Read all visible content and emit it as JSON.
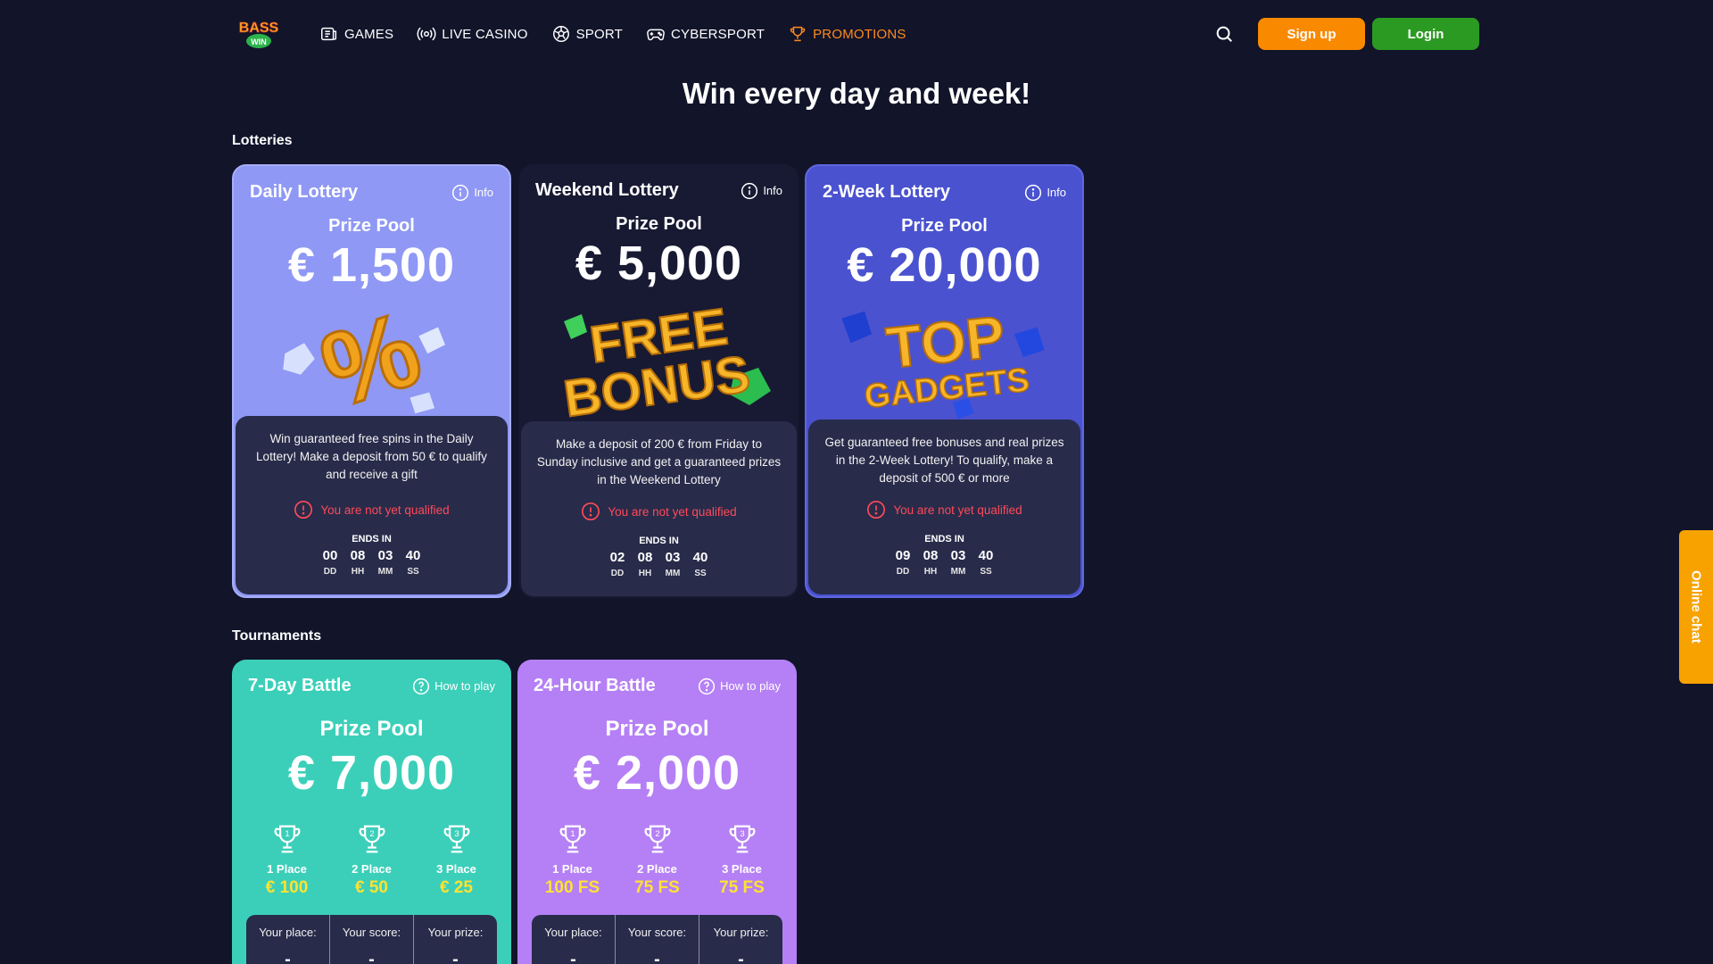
{
  "header": {
    "logo_text": "BASS WIN",
    "nav": [
      {
        "label": "GAMES",
        "icon": "games-icon"
      },
      {
        "label": "LIVE CASINO",
        "icon": "live-casino-icon"
      },
      {
        "label": "SPORT",
        "icon": "soccer-ball-icon"
      },
      {
        "label": "CYBERSPORT",
        "icon": "gamepad-icon"
      },
      {
        "label": "PROMOTIONS",
        "icon": "trophy-icon",
        "active": true
      }
    ],
    "signup_label": "Sign up",
    "login_label": "Login"
  },
  "page_title": "Win every day and week!",
  "lotteries": {
    "section_title": "Lotteries",
    "cards": [
      {
        "name": "Daily Lottery",
        "info_label": "Info",
        "prize_label": "Prize Pool",
        "prize_amount": "€ 1,500",
        "art": "percent-crystals",
        "description": "Win guaranteed free spins in the Daily Lottery! Make a deposit from 50 € to qualify and receive a gift",
        "status": "You are not yet qualified",
        "ends_in_label": "ENDS IN",
        "timer": [
          {
            "v": "00",
            "l": "DD"
          },
          {
            "v": "08",
            "l": "HH"
          },
          {
            "v": "03",
            "l": "MM"
          },
          {
            "v": "40",
            "l": "SS"
          }
        ],
        "bg_color": "#8f98f4"
      },
      {
        "name": "Weekend Lottery",
        "info_label": "Info",
        "prize_label": "Prize Pool",
        "prize_amount": "€ 5,000",
        "art": "free-bonus",
        "description": "Make a deposit of 200 € from Friday to Sunday inclusive and get a guaranteed prizes in the Weekend Lottery",
        "status": "You are not yet qualified",
        "ends_in_label": "ENDS IN",
        "timer": [
          {
            "v": "02",
            "l": "DD"
          },
          {
            "v": "08",
            "l": "HH"
          },
          {
            "v": "03",
            "l": "MM"
          },
          {
            "v": "40",
            "l": "SS"
          }
        ],
        "bg_color": "#181a33"
      },
      {
        "name": "2-Week Lottery",
        "info_label": "Info",
        "prize_label": "Prize Pool",
        "prize_amount": "€ 20,000",
        "art": "top-gadgets",
        "description": "Get guaranteed free bonuses and real prizes in the 2-Week Lottery! To qualify, make a deposit of 500 € or more",
        "status": "You are not yet qualified",
        "ends_in_label": "ENDS IN",
        "timer": [
          {
            "v": "09",
            "l": "DD"
          },
          {
            "v": "08",
            "l": "HH"
          },
          {
            "v": "03",
            "l": "MM"
          },
          {
            "v": "40",
            "l": "SS"
          }
        ],
        "bg_color": "#4a52cf"
      }
    ]
  },
  "tournaments": {
    "section_title": "Tournaments",
    "cards": [
      {
        "name": "7-Day Battle",
        "how_label": "How to play",
        "prize_label": "Prize Pool",
        "prize_amount": "€ 7,000",
        "places": [
          {
            "num": "1",
            "name": "1 Place",
            "prize": "€ 100"
          },
          {
            "num": "2",
            "name": "2 Place",
            "prize": "€ 50"
          },
          {
            "num": "3",
            "name": "3 Place",
            "prize": "€ 25"
          }
        ],
        "your_place_label": "Your place:",
        "your_score_label": "Your score:",
        "your_prize_label": "Your prize:",
        "your_place": "-",
        "your_score": "-",
        "your_prize": "-",
        "bg_color": "#3bcfb9"
      },
      {
        "name": "24-Hour Battle",
        "how_label": "How to play",
        "prize_label": "Prize Pool",
        "prize_amount": "€ 2,000",
        "places": [
          {
            "num": "1",
            "name": "1 Place",
            "prize": "100 FS"
          },
          {
            "num": "2",
            "name": "2 Place",
            "prize": "75 FS"
          },
          {
            "num": "3",
            "name": "3 Place",
            "prize": "75 FS"
          }
        ],
        "your_place_label": "Your place:",
        "your_score_label": "Your score:",
        "your_prize_label": "Your prize:",
        "your_place": "-",
        "your_score": "-",
        "your_prize": "-",
        "bg_color": "#b580f5"
      }
    ]
  },
  "chat_tab_label": "Online chat",
  "colors": {
    "background": "#12142a",
    "accent_orange": "#f98a00",
    "login_green": "#2b9a22",
    "warning_red": "#ff4a58",
    "prize_yellow": "#ffe232"
  }
}
